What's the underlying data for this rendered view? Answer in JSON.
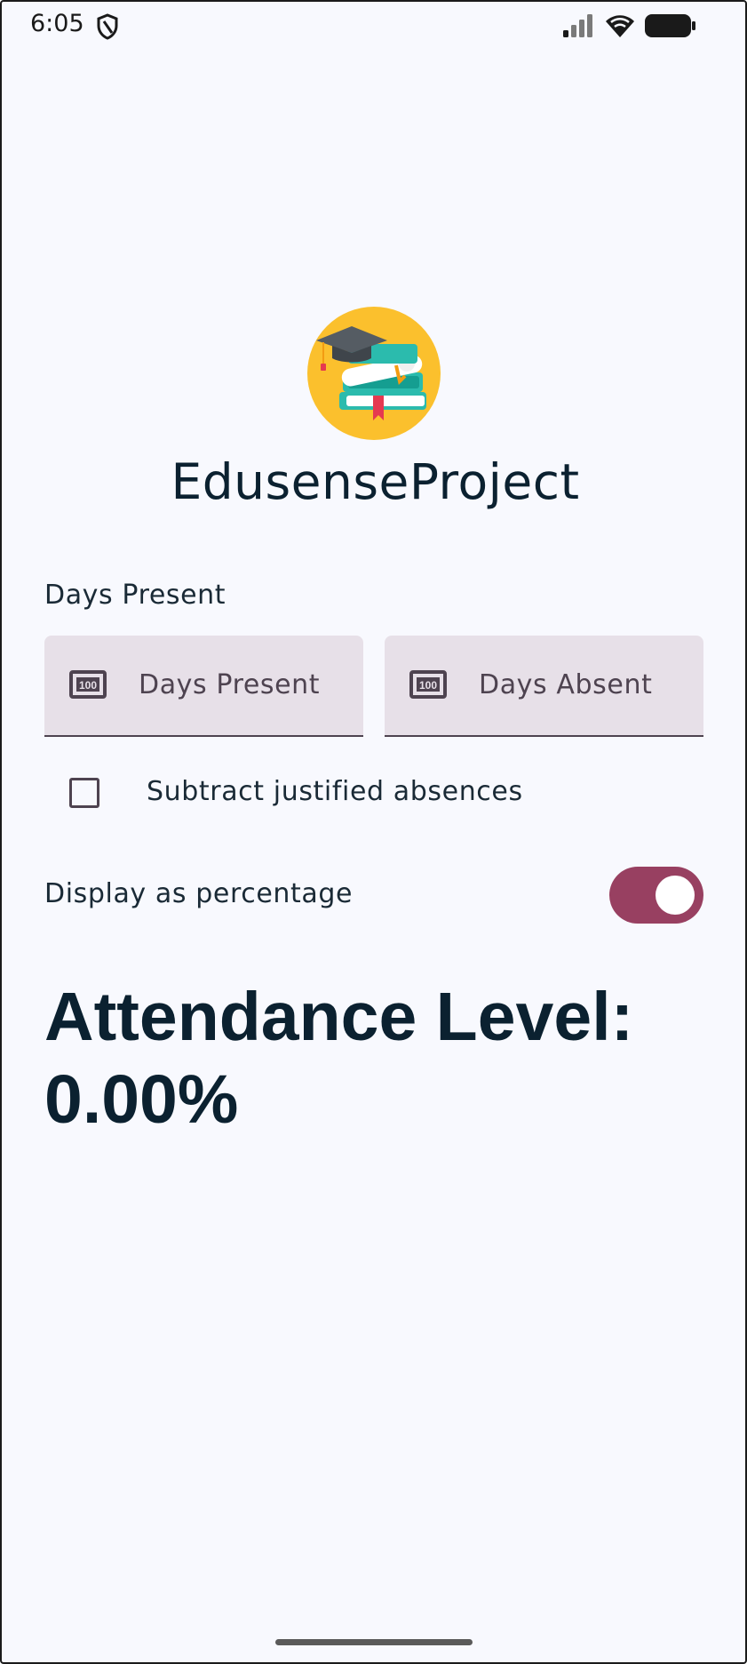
{
  "status_bar": {
    "time": "6:05",
    "icons": [
      "shield-icon",
      "cellular-signal-icon",
      "wifi-icon",
      "battery-icon"
    ]
  },
  "app": {
    "title": "EdusenseProject",
    "logo": "graduation-books-logo"
  },
  "form": {
    "section_label": "Days Present",
    "days_present": {
      "placeholder": "Days Present",
      "value": "",
      "icon": "numeric-keypad-icon"
    },
    "days_absent": {
      "placeholder": "Days Absent",
      "value": "",
      "icon": "numeric-keypad-icon"
    },
    "subtract_justified": {
      "label": "Subtract justified absences",
      "checked": false
    },
    "display_percentage": {
      "label": "Display as percentage",
      "on": true
    }
  },
  "result": {
    "text": "Attendance Level: 0.00%"
  },
  "colors": {
    "background": "#f8f9fe",
    "field_background": "#e7e0e8",
    "accent": "#984061",
    "text_primary": "#0b2130",
    "logo_circle": "#fbc02d"
  }
}
